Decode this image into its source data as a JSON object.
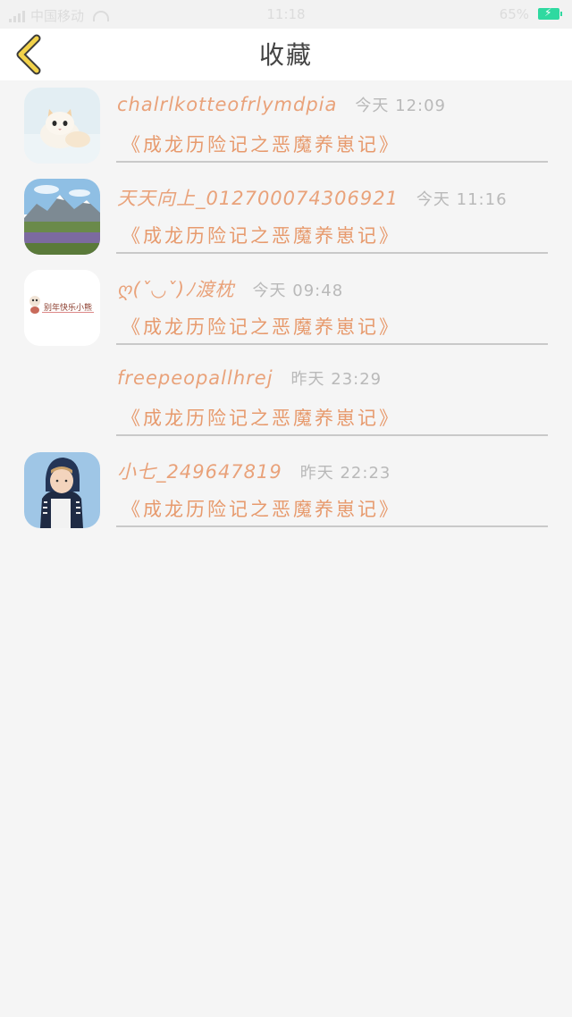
{
  "status_bar": {
    "carrier": "中国移动",
    "time": "11:18",
    "battery_pct": "65%",
    "battery_color": "#2fd9a0"
  },
  "nav": {
    "back_icon": "chevron-left-icon",
    "title": "收藏",
    "accent": "#e9a27a"
  },
  "items": [
    {
      "avatar": "kitten",
      "username": "chalrlkotteofrlymdpia",
      "time": "今天 12:09",
      "book": "《成龙历险记之恶魔养崽记》"
    },
    {
      "avatar": "mountain-landscape",
      "username": "天天向上_012700074306921",
      "time": "今天 11:16",
      "book": "《成龙历险记之恶魔养崽记》"
    },
    {
      "avatar": "cartoon-sticker",
      "avatar_caption": "别年快乐小熊",
      "username": "ღ(ˇ◡ˇ)ﾉ渡枕",
      "time": "今天 09:48",
      "book": "《成龙历险记之恶魔养崽记》"
    },
    {
      "avatar": "",
      "username": "freepeopallhrej",
      "time": "昨天 23:29",
      "book": "《成龙历险记之恶魔养崽记》"
    },
    {
      "avatar": "child-in-hoodie",
      "username": "小七_249647819",
      "time": "昨天 22:23",
      "book": "《成龙历险记之恶魔养崽记》"
    }
  ]
}
